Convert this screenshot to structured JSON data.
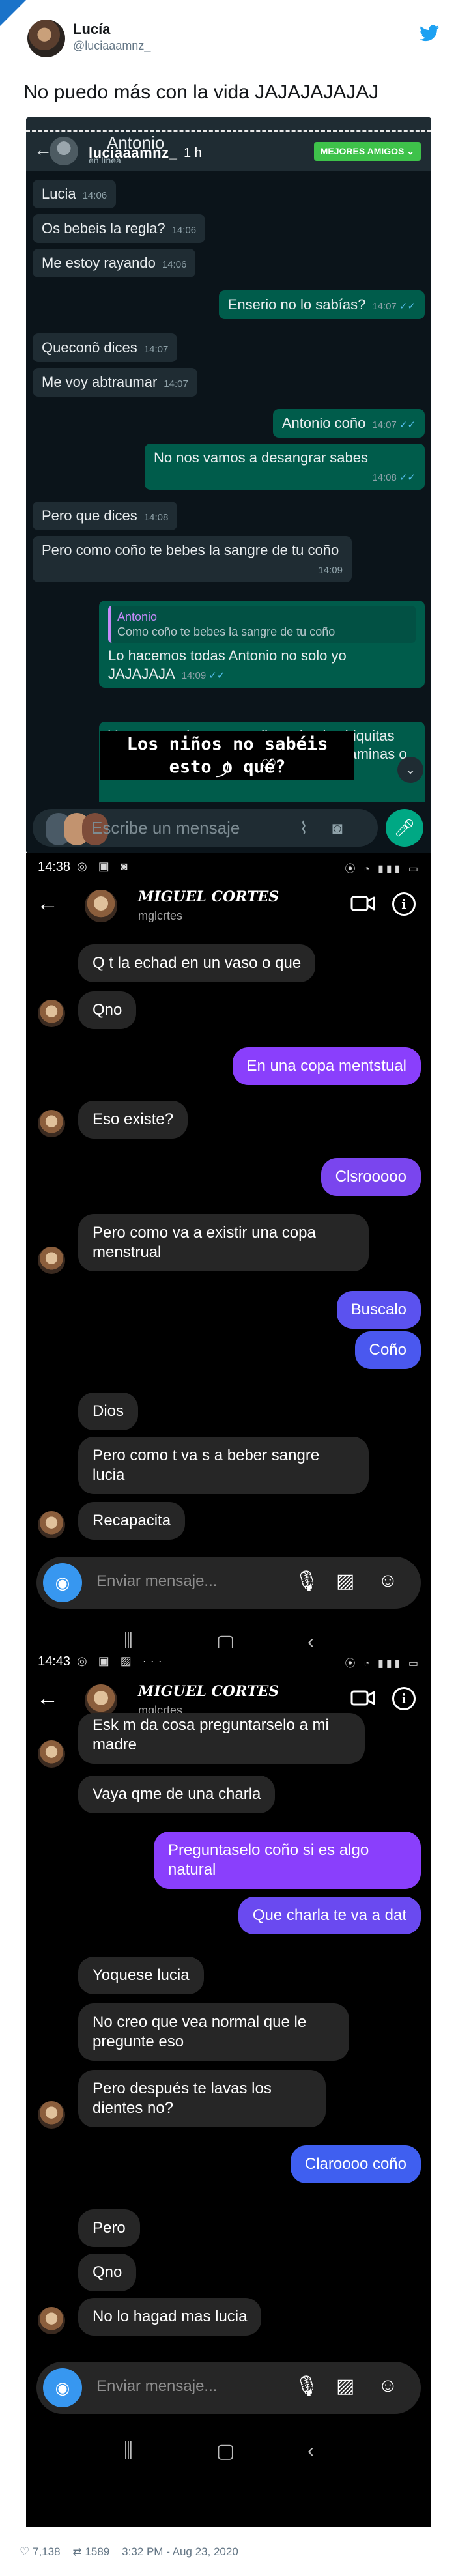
{
  "tweet": {
    "name": "Lucía",
    "handle": "@luciaaamnz_",
    "text": "No puedo más con la vida JAJAJAJAJAJ",
    "likes": "7,138",
    "retweets": "1589",
    "timestamp": "3:32 PM - Aug 23, 2020"
  },
  "whatsapp": {
    "contact": "Antonio",
    "status": "en línea",
    "overlay_user": "luciaaamnz_",
    "overlay_time": "1 h",
    "best_friends_label": "MEJORES AMIGOS",
    "input_placeholder": "Escribe un mensaje",
    "caption_overlay": "Los niños no sabéis esto o qué?",
    "messages": [
      {
        "dir": "in",
        "text": "Lucia",
        "time": "14:06"
      },
      {
        "dir": "in",
        "text": "Os bebeis la regla?",
        "time": "14:06"
      },
      {
        "dir": "in",
        "text": "Me estoy rayando",
        "time": "14:06"
      },
      {
        "dir": "out",
        "text": "Enserio no lo sabías?",
        "time": "14:07"
      },
      {
        "dir": "in",
        "text": "Queconõ dices",
        "time": "14:07"
      },
      {
        "dir": "in",
        "text": "Me voy abtraumar",
        "time": "14:07"
      },
      {
        "dir": "out",
        "text": "Antonio coño",
        "time": "14:07"
      },
      {
        "dir": "out",
        "text": "No nos vamos a desangrar sabes",
        "time": "14:08"
      },
      {
        "dir": "in",
        "text": "Pero que dices",
        "time": "14:08"
      },
      {
        "dir": "in",
        "text": "Pero como coño te bebes la sangre de tu coño",
        "time": "14:09"
      },
      {
        "dir": "out",
        "text": "Lo hacemos todas Antonio no solo yo JAJAJAJA",
        "time": "14:09",
        "quote_author": "Antonio",
        "quote_text": "Como coño te bebes la sangre de tu coño"
      },
      {
        "dir": "out",
        "text": "Yoquese es lo que nos dicen desde chiquitas porque a las enfermedades y tener vitaminas o",
        "time": ""
      }
    ]
  },
  "instagram1": {
    "status_time": "14:38",
    "name": "MIGUEL CORTES",
    "username": "mglcrtes",
    "input_placeholder": "Enviar mensaje...",
    "messages": [
      {
        "dir": "in",
        "text": "Q t la echad en un vaso o que"
      },
      {
        "dir": "in",
        "text": "Qno"
      },
      {
        "dir": "out",
        "text": "En una copa mentstual"
      },
      {
        "dir": "in",
        "text": "Eso existe?"
      },
      {
        "dir": "out",
        "text": "Clsrooooo"
      },
      {
        "dir": "in",
        "text": "Pero como va a existir una copa menstrual"
      },
      {
        "dir": "out",
        "text": "Buscalo"
      },
      {
        "dir": "out",
        "text": "Coño"
      },
      {
        "dir": "in",
        "text": "Dios"
      },
      {
        "dir": "in",
        "text": "Pero como t va s a beber sangre lucia"
      },
      {
        "dir": "in",
        "text": "Recapacita"
      }
    ]
  },
  "instagram2": {
    "status_time": "14:43",
    "name": "MIGUEL CORTES",
    "username": "mglcrtes",
    "input_placeholder": "Enviar mensaje...",
    "messages": [
      {
        "dir": "in",
        "text": "Esk m da cosa preguntarselo a mi madre"
      },
      {
        "dir": "in",
        "text": "Vaya qme de una charla"
      },
      {
        "dir": "out",
        "text": "Preguntaselo coño si es algo natural"
      },
      {
        "dir": "out",
        "text": "Que charla te va a dat"
      },
      {
        "dir": "in",
        "text": "Yoquese lucia"
      },
      {
        "dir": "in",
        "text": "No creo que vea normal que le pregunte eso"
      },
      {
        "dir": "in",
        "text": "Pero después te lavas los dientes no?"
      },
      {
        "dir": "out",
        "text": "Claroooo coño"
      },
      {
        "dir": "in",
        "text": "Pero"
      },
      {
        "dir": "in",
        "text": "Qno"
      },
      {
        "dir": "in",
        "text": "No lo hagad mas lucia"
      }
    ]
  },
  "colors": {
    "wa_out": "#005c4b",
    "wa_in": "#1f2c33",
    "ig_purple": "#8a3ffc",
    "ig_blue": "#3f5ff0",
    "twitter_blue": "#1da1f2"
  },
  "icons": [
    "twitter-bird-icon",
    "back-arrow-icon",
    "video-call-icon",
    "info-icon",
    "camera-icon",
    "microphone-icon",
    "gallery-icon",
    "sticker-icon",
    "attach-icon",
    "share-icon",
    "heart-icon",
    "retweet-icon"
  ]
}
